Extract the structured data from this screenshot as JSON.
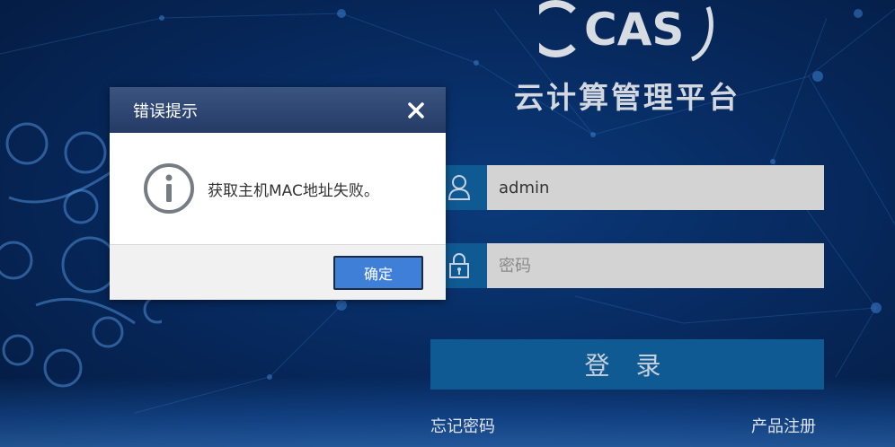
{
  "logo": {
    "text": "CAS"
  },
  "platform_title": "云计算管理平台",
  "login": {
    "username_value": "admin",
    "password_placeholder": "密码",
    "login_label": "登 录",
    "forgot_password": "忘记密码",
    "product_register": "产品注册"
  },
  "dialog": {
    "title": "错误提示",
    "message": "获取主机MAC地址失败。",
    "confirm_label": "确定"
  },
  "colors": {
    "accent": "#0f5a93",
    "dialog_header": "#2b4470",
    "confirm_button": "#3f7fd8",
    "input_bg": "#d3d3d3"
  },
  "icons": [
    "user-icon",
    "lock-icon",
    "info-icon",
    "close-icon"
  ]
}
